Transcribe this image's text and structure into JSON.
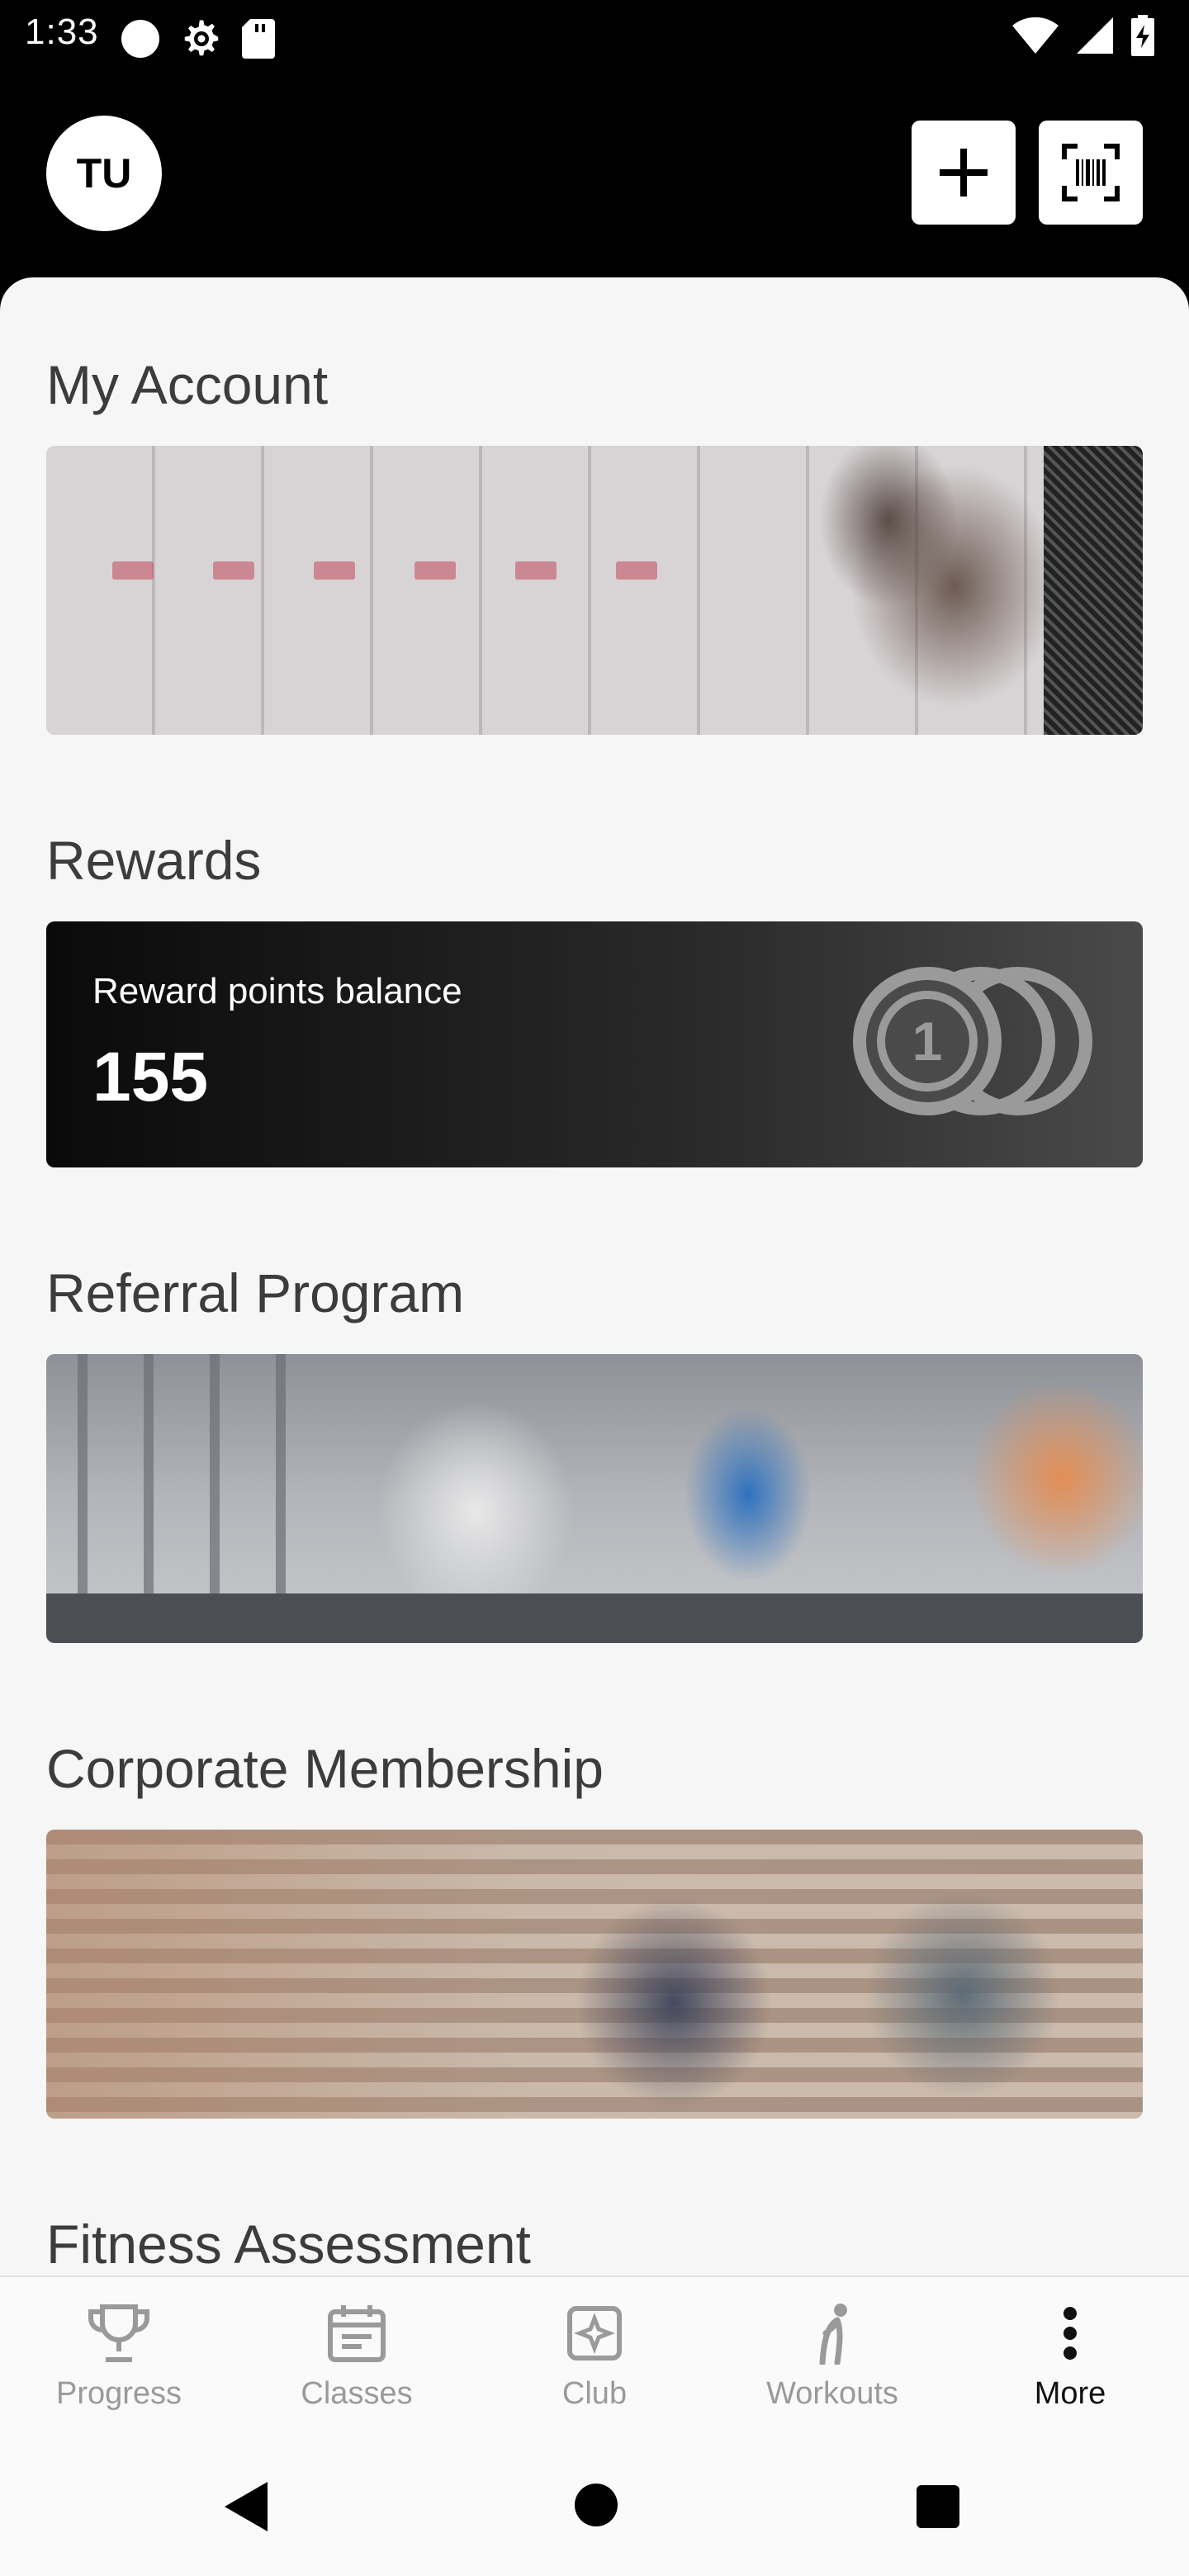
{
  "status_bar": {
    "time": "1:33",
    "icons": [
      "circle-notification-icon",
      "gear-icon",
      "sd-card-icon",
      "wifi-icon",
      "signal-icon",
      "battery-charging-icon"
    ]
  },
  "header": {
    "avatar_initials": "TU",
    "add_icon": "plus-icon",
    "scan_icon": "barcode-scan-icon"
  },
  "sections": {
    "account": {
      "title": "My Account"
    },
    "rewards": {
      "title": "Rewards",
      "balance_label": "Reward points balance",
      "balance_value": "155",
      "coin_number": "1"
    },
    "referral": {
      "title": "Referral Program"
    },
    "corporate": {
      "title": "Corporate Membership"
    },
    "fitness": {
      "title": "Fitness Assessment"
    }
  },
  "bottom_nav": {
    "items": [
      {
        "label": "Progress",
        "icon": "trophy-icon"
      },
      {
        "label": "Classes",
        "icon": "calendar-icon"
      },
      {
        "label": "Club",
        "icon": "club-icon"
      },
      {
        "label": "Workouts",
        "icon": "runner-icon"
      },
      {
        "label": "More",
        "icon": "more-vertical-icon"
      }
    ],
    "active": "More"
  },
  "colors": {
    "header_bg": "#000000",
    "content_bg": "#f6f6f6",
    "title_text": "#3c3c3c",
    "nav_inactive": "#9a9a9a",
    "nav_active": "#111111"
  }
}
